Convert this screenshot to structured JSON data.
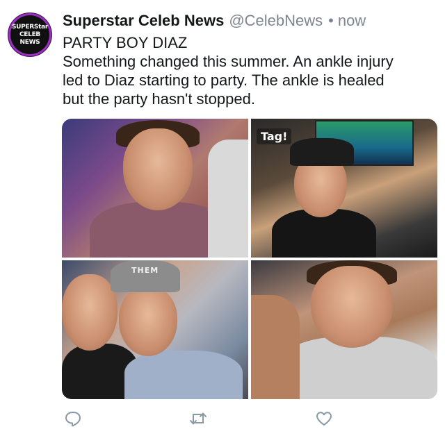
{
  "tweet": {
    "avatar": {
      "line1": "SUPERStar",
      "line2": "CELEB",
      "line3": "NEWS"
    },
    "display_name": "Superstar Celeb News",
    "handle": "@CelebNews",
    "separator": "•",
    "time": "now",
    "text_lines": [
      "PARTY BOY DIAZ",
      "Something changed this summer. An ankle injury",
      "led to Diaz starting to party. The ankle is healed",
      "but the party hasn't stopped."
    ],
    "photos": {
      "p2_overlay": "Tag!",
      "p3_cap_text": "THEM"
    }
  },
  "actions": {
    "reply_icon": "speech-bubble-icon",
    "retweet_icon": "retweet-icon",
    "like_icon": "heart-icon",
    "icon_color": "#8899a6"
  },
  "colors": {
    "name": "#14171a",
    "muted": "#7d868f",
    "avatar_ring": "#9b2fc0"
  }
}
